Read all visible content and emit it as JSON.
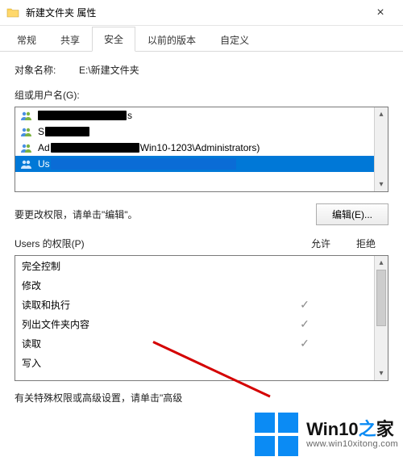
{
  "titlebar": {
    "title": "新建文件夹 属性",
    "close": "×"
  },
  "tabs": [
    {
      "label": "常规",
      "active": false
    },
    {
      "label": "共享",
      "active": false
    },
    {
      "label": "安全",
      "active": true
    },
    {
      "label": "以前的版本",
      "active": false
    },
    {
      "label": "自定义",
      "active": false
    }
  ],
  "object": {
    "label": "对象名称:",
    "value": "E:\\新建文件夹"
  },
  "groups": {
    "label": "组或用户名(G):",
    "items": [
      {
        "suffix": "s"
      },
      {
        "prefix": "S"
      },
      {
        "prefix": "Ad",
        "suffix": "Win10-1203\\Administrators)"
      },
      {
        "prefix": "Us",
        "selected": true
      }
    ]
  },
  "edit": {
    "hint": "要更改权限，请单击\"编辑\"。",
    "button": "编辑(E)..."
  },
  "permissions": {
    "header_name": "Users 的权限(P)",
    "header_allow": "允许",
    "header_deny": "拒绝",
    "rows": [
      {
        "name": "完全控制",
        "allow": false,
        "deny": false
      },
      {
        "name": "修改",
        "allow": false,
        "deny": false
      },
      {
        "name": "读取和执行",
        "allow": true,
        "deny": false
      },
      {
        "name": "列出文件夹内容",
        "allow": true,
        "deny": false
      },
      {
        "name": "读取",
        "allow": true,
        "deny": false
      },
      {
        "name": "写入",
        "allow": false,
        "deny": false
      }
    ]
  },
  "advanced": {
    "text": "有关特殊权限或高级设置，请单击\"高级"
  },
  "watermark": {
    "brand_a": "Win10",
    "brand_b": "之",
    "brand_c": "家",
    "url": "www.win10xitong.com"
  }
}
